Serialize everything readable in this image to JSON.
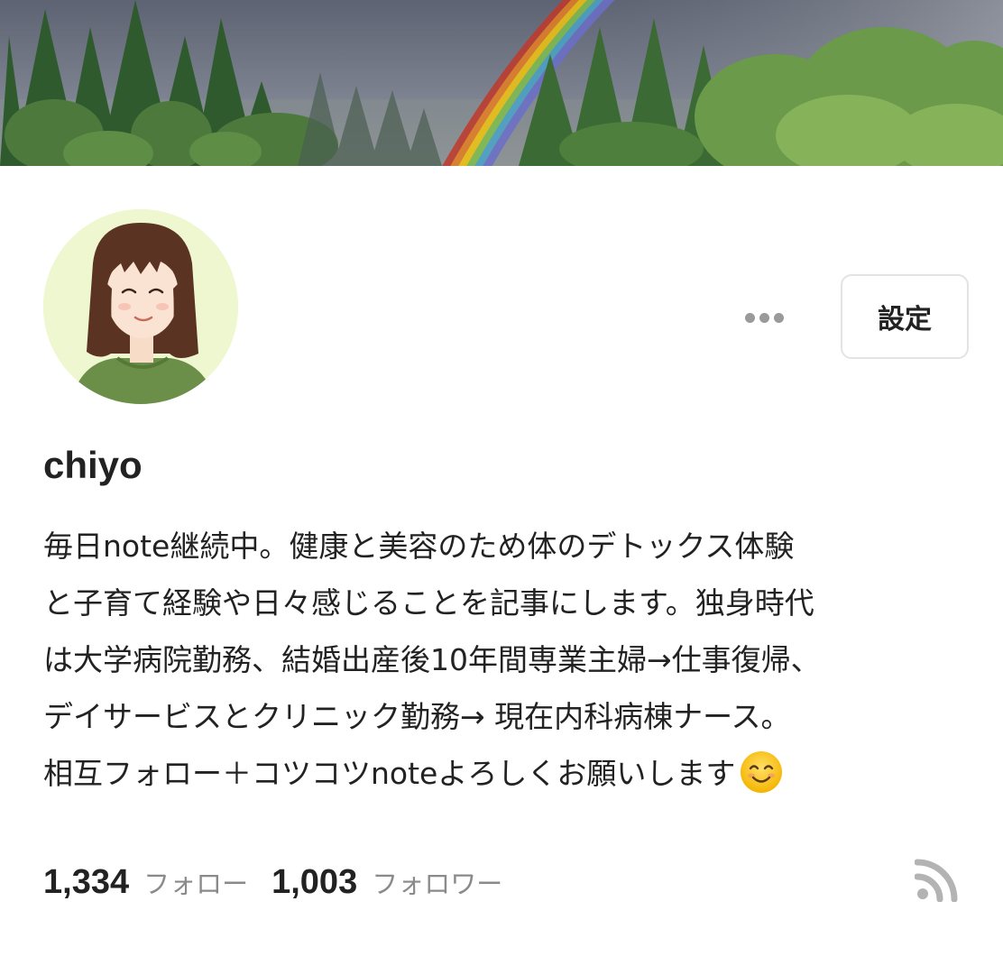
{
  "profile": {
    "name": "chiyo",
    "bio_lines": [
      "毎日note継続中。健康と美容のため体のデトックス体験",
      "と子育て経験や日々感じることを記事にします。独身時代",
      "は大学病院勤務、結婚出産後10年間専業主婦→仕事復帰、",
      "デイサービスとクリニック勤務→ 現在内科病棟ナース。",
      "相互フォロー＋コツコツnoteよろしくお願いします"
    ],
    "bio_emoji": "smiling-face-emoji"
  },
  "actions": {
    "more_icon": "more-horizontal-icon",
    "settings_label": "設定"
  },
  "stats": {
    "following_count": "1,334",
    "following_label": "フォロー",
    "followers_count": "1,003",
    "followers_label": "フォロワー"
  },
  "icons": {
    "rss": "rss-feed-icon",
    "header": "rainbow-forest-header-image",
    "avatar": "illustrated-avatar"
  },
  "colors": {
    "text": "#222222",
    "muted": "#8a8a8a",
    "button_border": "#e3e3e3",
    "icon_gray": "#9a9a9a",
    "avatar_bg": "#eef7cf"
  }
}
